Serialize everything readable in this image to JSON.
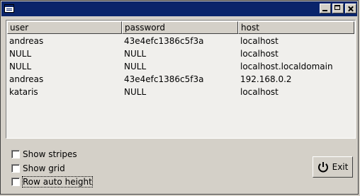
{
  "window": {
    "title": ""
  },
  "table": {
    "columns": [
      "user",
      "password",
      "host"
    ],
    "rows": [
      [
        "andreas",
        "43e4efc1386c5f3a",
        "localhost"
      ],
      [
        "NULL",
        "NULL",
        "localhost"
      ],
      [
        "NULL",
        "NULL",
        "localhost.localdomain"
      ],
      [
        "andreas",
        "43e4efc1386c5f3a",
        "192.168.0.2"
      ],
      [
        "kataris",
        "NULL",
        "localhost"
      ]
    ]
  },
  "options": {
    "show_stripes": {
      "label": "Show stripes",
      "checked": false
    },
    "show_grid": {
      "label": "Show grid",
      "checked": false
    },
    "row_auto_height": {
      "label": "Row auto height",
      "checked": false
    }
  },
  "exit_button": {
    "label": "Exit",
    "icon": "power-icon"
  }
}
